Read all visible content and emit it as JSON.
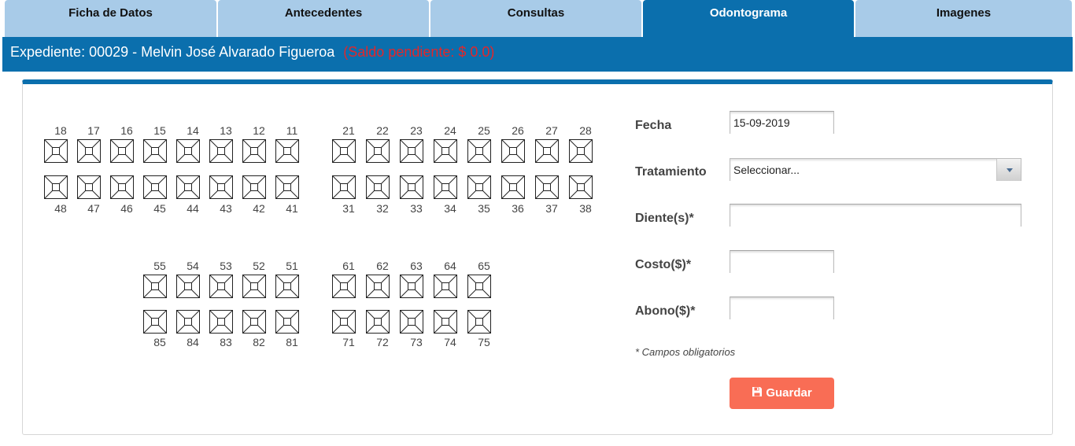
{
  "tabs": [
    "Ficha de Datos",
    "Antecedentes",
    "Consultas",
    "Odontograma",
    "Imagenes"
  ],
  "active_tab": 3,
  "header": {
    "expediente": "Expediente: 00029 - Melvin José Alvarado Figueroa",
    "saldo": "(Saldo pendiente: $ 0.0)"
  },
  "odontogram": {
    "permanent_upper": [
      "18",
      "17",
      "16",
      "15",
      "14",
      "13",
      "12",
      "11",
      "21",
      "22",
      "23",
      "24",
      "25",
      "26",
      "27",
      "28"
    ],
    "permanent_lower": [
      "48",
      "47",
      "46",
      "45",
      "44",
      "43",
      "42",
      "41",
      "31",
      "32",
      "33",
      "34",
      "35",
      "36",
      "37",
      "38"
    ],
    "primary_upper": [
      "55",
      "54",
      "53",
      "52",
      "51",
      "61",
      "62",
      "63",
      "64",
      "65"
    ],
    "primary_lower": [
      "85",
      "84",
      "83",
      "82",
      "81",
      "71",
      "72",
      "73",
      "74",
      "75"
    ]
  },
  "form": {
    "fecha_label": "Fecha",
    "fecha_value": "15-09-2019",
    "tratamiento_label": "Tratamiento",
    "tratamiento_value": "Seleccionar...",
    "dientes_label": "Diente(s)*",
    "dientes_value": "",
    "costo_label": "Costo($)*",
    "costo_value": "",
    "abono_label": "Abono($)*",
    "abono_value": "",
    "note": "* Campos obligatorios",
    "save_label": "Guardar"
  },
  "colors": {
    "primary": "#0b6fad",
    "tab_inactive": "#a8cbe8",
    "saldo": "#e3262a",
    "save_button": "#f96d55"
  }
}
